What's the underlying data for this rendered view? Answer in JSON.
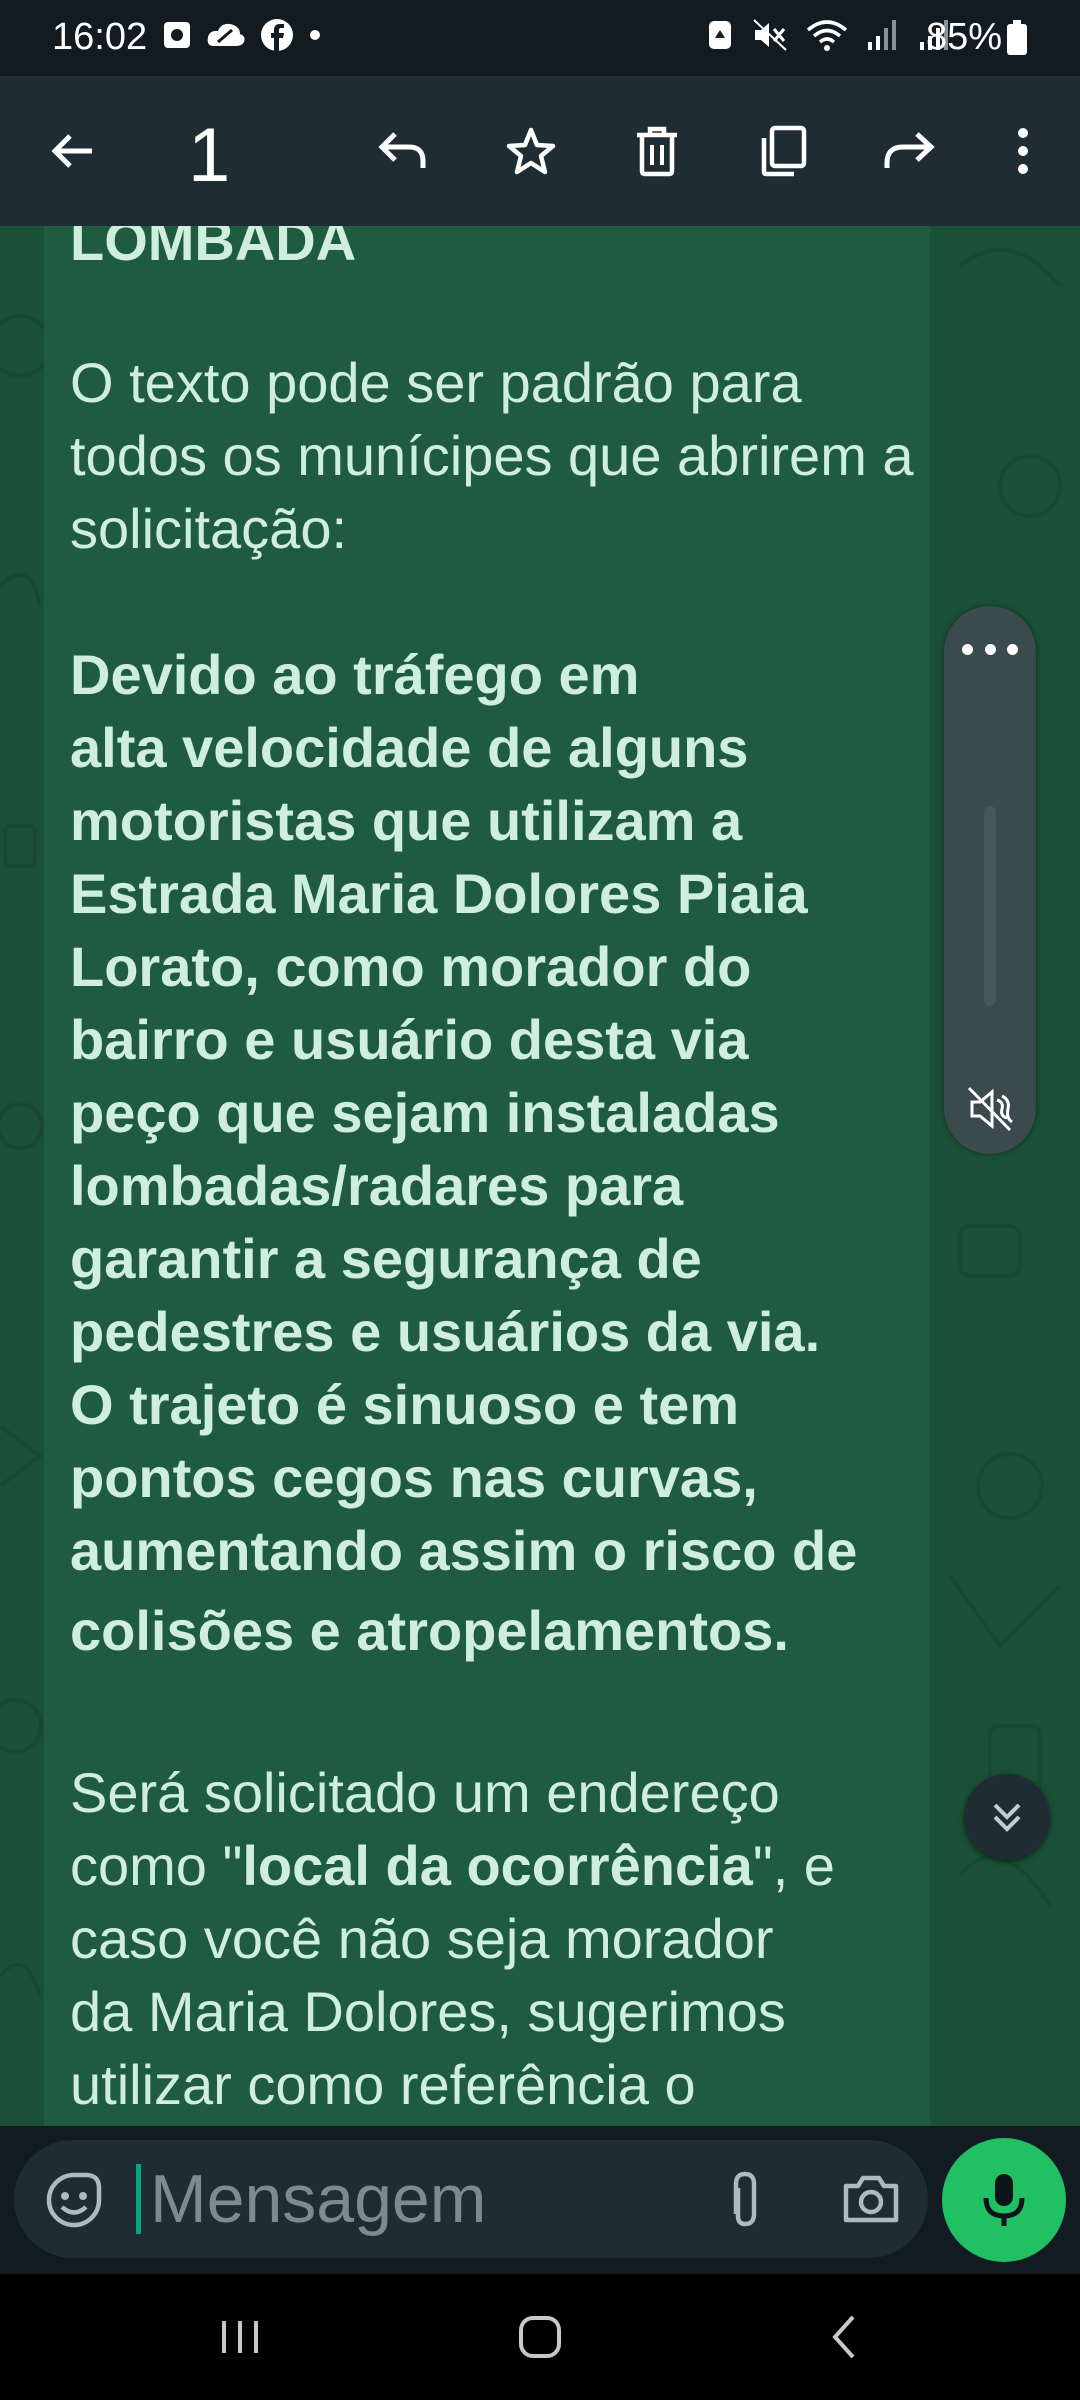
{
  "status_bar": {
    "time": "16:02",
    "battery_percent": "85%",
    "left_icons": [
      "square-app-icon",
      "cloud-icon",
      "facebook-icon",
      "dot-icon"
    ],
    "right_icons": [
      "recycle-icon",
      "mute-icon",
      "wifi-icon",
      "signal-icon",
      "signal-icon",
      "battery-icon"
    ]
  },
  "toolbar": {
    "selected_count": "1",
    "actions": [
      "back-arrow-icon",
      "reply-icon",
      "star-icon",
      "delete-icon",
      "copy-icon",
      "forward-icon",
      "more-options-icon"
    ]
  },
  "message": {
    "heading_fragment": "LOMBADA",
    "intro": "O texto pode ser padrão para todos os munícipes que abrirem a solicitação:",
    "bold_lines": [
      "Devido ao tráfego em",
      "alta velocidade de alguns",
      "motoristas que utilizam a",
      "Estrada Maria Dolores Piaia",
      "Lorato, como morador do",
      "bairro e usuário desta via",
      "peço que sejam instaladas",
      "lombadas/radares para",
      "garantir a segurança de",
      "pedestres e usuários da via.",
      "O trajeto é sinuoso e tem",
      "pontos cegos nas curvas,",
      "aumentando assim o risco de",
      "colisões e atropelamentos."
    ],
    "outro_line1": "Será solicitado um endereço",
    "outro_line2_prefix": "como \"",
    "outro_line2_bold": "local da ocorrência",
    "outro_line2_suffix": "\",  e",
    "outro_line3": "caso você não seja morador",
    "outro_line4": "da Maria Dolores, sugerimos",
    "outro_line5": "utilizar como referência o"
  },
  "voice_panel": {
    "more_icon": "more-horizontal-icon",
    "mute_icon": "volume-mute-icon"
  },
  "composer": {
    "placeholder": "Mensagem",
    "value": ""
  },
  "nav_bar": [
    "recent-apps-icon",
    "home-icon",
    "back-icon"
  ]
}
